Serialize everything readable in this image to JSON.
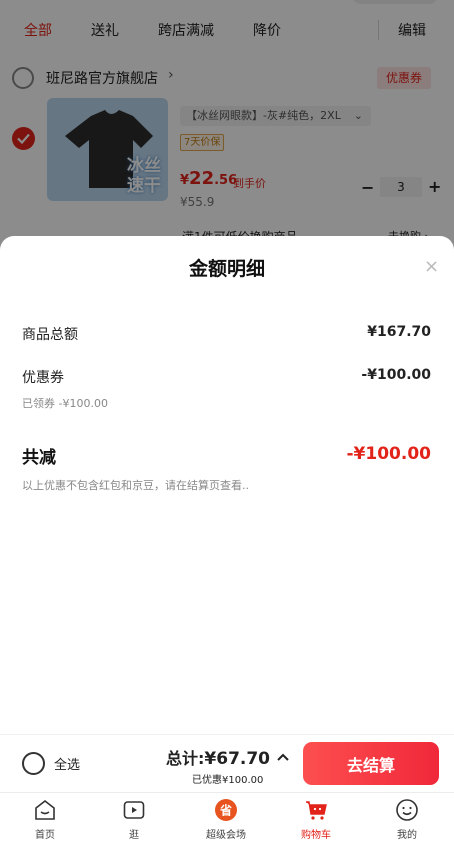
{
  "cart": {
    "tabs": [
      {
        "label": "全部",
        "active": true
      },
      {
        "label": "送礼"
      },
      {
        "label": "跨店满减"
      },
      {
        "label": "降价"
      }
    ],
    "edit_label": "编辑",
    "shop": {
      "name": "班尼路官方旗舰店",
      "chevron": "›",
      "coupon_label": "优惠券"
    },
    "item": {
      "image_text": "冰丝 速干",
      "spec": "【冰丝网眼款】-灰#纯色，2XL",
      "guarantee_tag": "7天价保",
      "price_symbol": "¥",
      "price_int": "22",
      "price_dec": ".56",
      "price_note": "到手价",
      "original_price": "¥55.9",
      "quantity": "3",
      "minus": "−",
      "plus": "+"
    },
    "promo_hint": "满1件可低价换购商品",
    "promo_link": "去换购 ›"
  },
  "sheet": {
    "title": "金额明细",
    "close": "×",
    "goods_total_label": "商品总额",
    "goods_total_value": "¥167.70",
    "coupon_label": "优惠券",
    "coupon_value": "-¥100.00",
    "coupon_sub": "已领券 -¥100.00",
    "total_reduce_label": "共减",
    "total_reduce_value": "-¥100.00",
    "note": "以上优惠不包含红包和京豆，请在结算页查看.."
  },
  "checkout": {
    "select_all": "全选",
    "total_prefix": "总计:",
    "total_amount": "¥67.70",
    "saved": "已优惠¥100.00",
    "button": "去结算"
  },
  "tabbar": [
    {
      "label": "首页",
      "icon": "home-icon"
    },
    {
      "label": "逛",
      "icon": "video-icon"
    },
    {
      "label": "超级会场",
      "icon": "super-venue-icon"
    },
    {
      "label": "购物车",
      "icon": "cart-icon",
      "active": true
    },
    {
      "label": "我的",
      "icon": "profile-icon"
    }
  ],
  "colors": {
    "accent": "#e2231a",
    "overlay": "rgba(0,0,0,0.45)"
  }
}
